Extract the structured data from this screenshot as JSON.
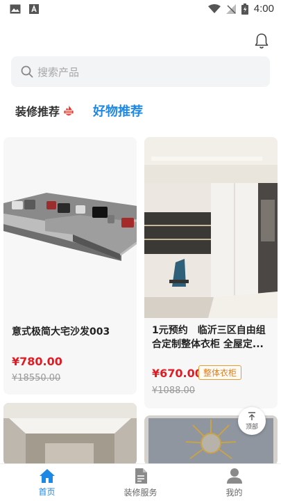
{
  "status_bar": {
    "time": "4:00"
  },
  "search": {
    "placeholder": "搜索产品"
  },
  "tabs": {
    "tab1": "装修推荐",
    "tab2": "好物推荐"
  },
  "products": [
    {
      "title": "意式极简大宅沙发003",
      "price": "¥780.00",
      "old_price": "¥18550.00"
    },
    {
      "title": "1元预约　临沂三区自由组合定制整体衣柜 全屋定...",
      "price": "¥670.00",
      "old_price": "¥1088.00",
      "tag": "整体衣柜"
    }
  ],
  "back_to_top": {
    "label": "顶部"
  },
  "bottom_nav": {
    "items": [
      {
        "label": "首页"
      },
      {
        "label": "装修服务"
      },
      {
        "label": "我的"
      }
    ]
  },
  "colors": {
    "accent": "#1e88e5",
    "price": "#e01b24",
    "tag": "#d9822b"
  }
}
